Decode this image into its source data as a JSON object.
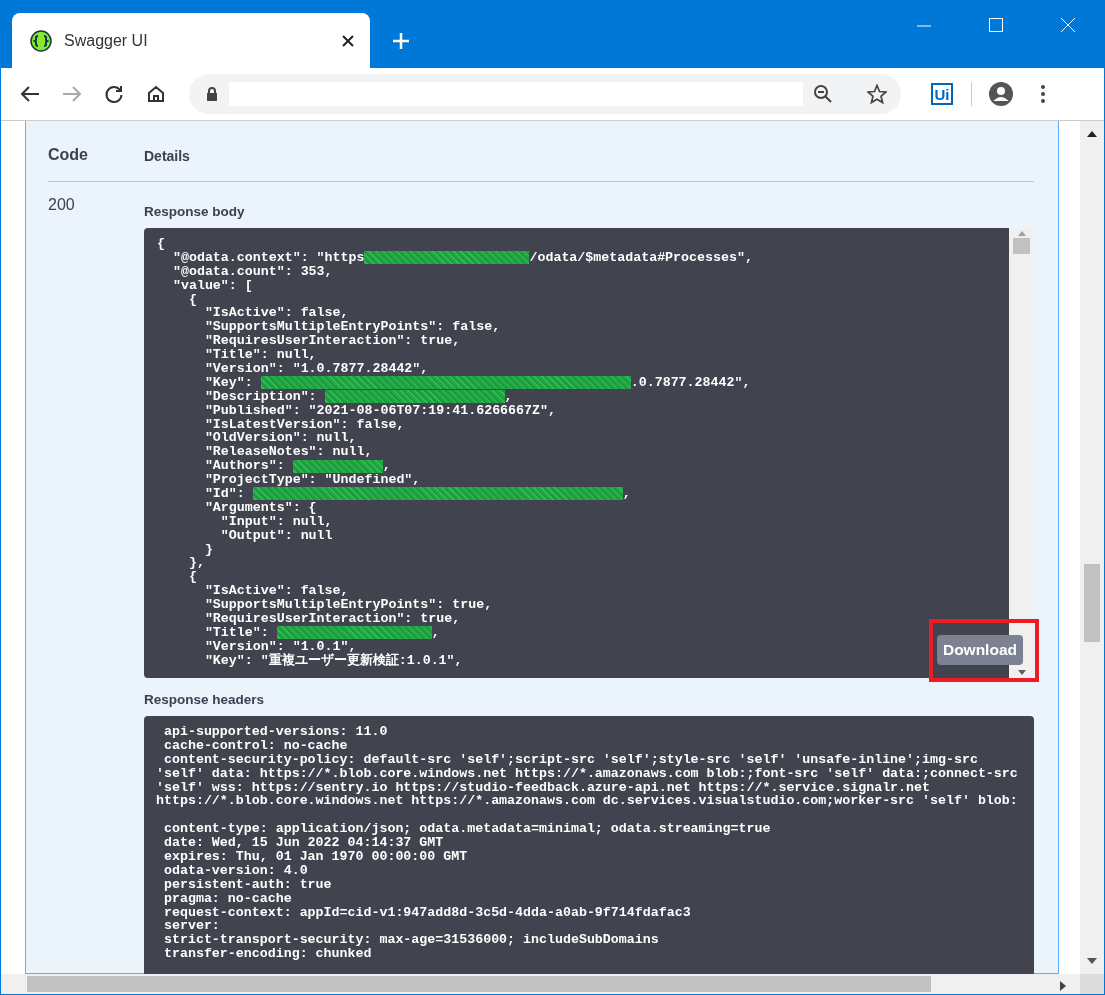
{
  "browser": {
    "tab_title": "Swagger UI",
    "extension_label": "Ui",
    "forward_disabled": true
  },
  "responses": {
    "columns": [
      "Code",
      "Details"
    ],
    "code": "200",
    "body_label": "Response body",
    "body_lines": [
      [
        {
          "text": "{"
        }
      ],
      [
        {
          "text": "  \"@odata.context\": \"https"
        },
        {
          "kind": "redaction"
        },
        {
          "text": "/odata/$metadata#Processes\","
        }
      ],
      [
        {
          "text": "  \"@odata.count\": 353,"
        }
      ],
      [
        {
          "text": "  \"value\": ["
        }
      ],
      [
        {
          "text": "    {"
        }
      ],
      [
        {
          "text": "      \"IsActive\": false,"
        }
      ],
      [
        {
          "text": "      \"SupportsMultipleEntryPoints\": false,"
        }
      ],
      [
        {
          "text": "      \"RequiresUserInteraction\": true,"
        }
      ],
      [
        {
          "text": "      \"Title\": null,"
        }
      ],
      [
        {
          "text": "      \"Version\": \"1.0.7877.28442\","
        }
      ],
      [
        {
          "text": "      \"Key\": "
        },
        {
          "kind": "redaction"
        },
        {
          "text": ".0.7877.28442\","
        }
      ],
      [
        {
          "text": "      \"Description\": "
        },
        {
          "kind": "redaction"
        },
        {
          "text": ","
        }
      ],
      [
        {
          "text": "      \"Published\": \"2021-08-06T07:19:41.6266667Z\","
        }
      ],
      [
        {
          "text": "      \"IsLatestVersion\": false,"
        }
      ],
      [
        {
          "text": "      \"OldVersion\": null,"
        }
      ],
      [
        {
          "text": "      \"ReleaseNotes\": null,"
        }
      ],
      [
        {
          "text": "      \"Authors\": "
        },
        {
          "kind": "redaction"
        },
        {
          "text": ","
        }
      ],
      [
        {
          "text": "      \"ProjectType\": \"Undefined\","
        }
      ],
      [
        {
          "text": "      \"Id\": "
        },
        {
          "kind": "redaction"
        },
        {
          "text": ","
        }
      ],
      [
        {
          "text": "      \"Arguments\": {"
        }
      ],
      [
        {
          "text": "        \"Input\": null,"
        }
      ],
      [
        {
          "text": "        \"Output\": null"
        }
      ],
      [
        {
          "text": "      }"
        }
      ],
      [
        {
          "text": "    },"
        }
      ],
      [
        {
          "text": "    {"
        }
      ],
      [
        {
          "text": "      \"IsActive\": false,"
        }
      ],
      [
        {
          "text": "      \"SupportsMultipleEntryPoints\": true,"
        }
      ],
      [
        {
          "text": "      \"RequiresUserInteraction\": true,"
        }
      ],
      [
        {
          "text": "      \"Title\": "
        },
        {
          "kind": "redaction"
        },
        {
          "text": ","
        }
      ],
      [
        {
          "text": "      \"Version\": \"1.0.1\","
        }
      ],
      [
        {
          "text": "      \"Key\": \"重複ユーザー更新検証:1.0.1\","
        }
      ]
    ],
    "download_button": {
      "label": "Download",
      "highlighted": true
    },
    "headers_label": "Response headers",
    "header_groups": [
      [
        " api-supported-versions: 11.0",
        " cache-control: no-cache",
        " content-security-policy: default-src 'self';script-src 'self';style-src 'self' 'unsafe-inline';img-src",
        "'self' data: https://*.blob.core.windows.net https://*.amazonaws.com blob:;font-src 'self' data:;connect-src",
        "'self' wss: https://sentry.io https://studio-feedback.azure-api.net https://*.service.signalr.net",
        "https://*.blob.core.windows.net https://*.amazonaws.com dc.services.visualstudio.com;worker-src 'self' blob:"
      ],
      [
        " content-type: application/json; odata.metadata=minimal; odata.streaming=true",
        " date: Wed, 15 Jun 2022 04:14:37 GMT",
        " expires: Thu, 01 Jan 1970 00:00:00 GMT",
        " odata-version: 4.0",
        " persistent-auth: true",
        " pragma: no-cache",
        " request-context: appId=cid-v1:947add8d-3c5d-4dda-a0ab-9f714fdafac3",
        " server:",
        " strict-transport-security: max-age=31536000; includeSubDomains",
        " transfer-encoding: chunked"
      ]
    ]
  }
}
